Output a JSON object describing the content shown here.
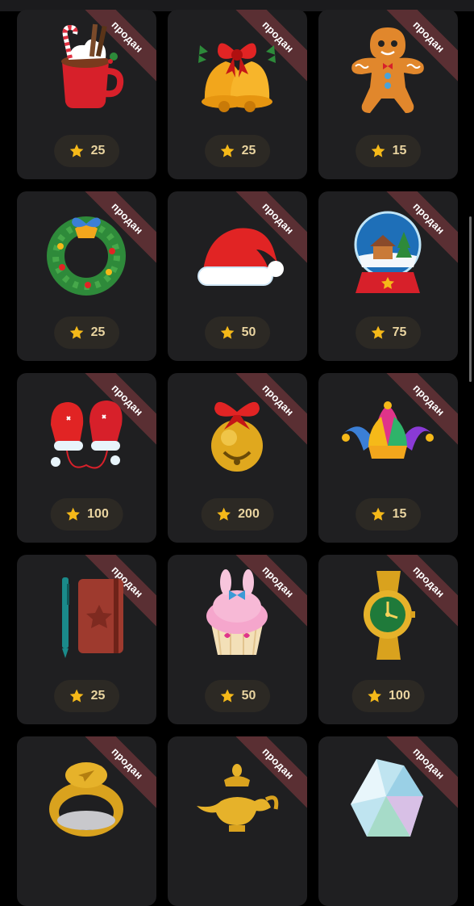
{
  "sold_label": "продан",
  "colors": {
    "card": "#1f1f21",
    "ribbon": "#5a2f33",
    "price_pill": "#2c2924",
    "price_text": "#e9d4a0",
    "star": "#f5b919"
  },
  "gifts": [
    {
      "name": "hot-chocolate",
      "icon": "hot-chocolate-icon",
      "price": "25"
    },
    {
      "name": "jingle-bells",
      "icon": "jingle-bells-icon",
      "price": "25"
    },
    {
      "name": "gingerbread-man",
      "icon": "gingerbread-man-icon",
      "price": "15"
    },
    {
      "name": "christmas-wreath",
      "icon": "christmas-wreath-icon",
      "price": "25"
    },
    {
      "name": "santa-hat",
      "icon": "santa-hat-icon",
      "price": "50"
    },
    {
      "name": "snow-globe",
      "icon": "snow-globe-icon",
      "price": "75"
    },
    {
      "name": "mittens",
      "icon": "mittens-icon",
      "price": "100"
    },
    {
      "name": "golden-bell",
      "icon": "golden-bell-icon",
      "price": "200"
    },
    {
      "name": "jester-hat",
      "icon": "jester-hat-icon",
      "price": "15"
    },
    {
      "name": "notebook",
      "icon": "notebook-icon",
      "price": "25"
    },
    {
      "name": "cupcake",
      "icon": "cupcake-icon",
      "price": "50"
    },
    {
      "name": "gold-watch",
      "icon": "gold-watch-icon",
      "price": "100"
    },
    {
      "name": "signet-ring",
      "icon": "signet-ring-icon",
      "price": ""
    },
    {
      "name": "magic-lamp",
      "icon": "magic-lamp-icon",
      "price": ""
    },
    {
      "name": "crystal",
      "icon": "crystal-icon",
      "price": ""
    }
  ]
}
